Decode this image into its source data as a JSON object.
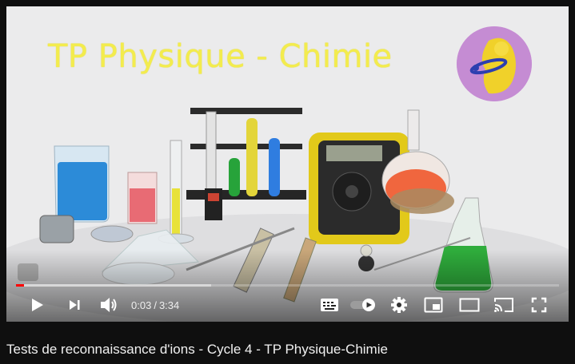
{
  "video": {
    "overlay_title": "TP Physique - Chimie",
    "title": "Tests de reconnaissance d'ions - Cycle 4 - TP Physique-Chimie"
  },
  "player": {
    "current_time": "0:03",
    "separator": "/",
    "duration": "3:34",
    "progress_fraction": 0.014,
    "buffered_fraction": 0.36,
    "autoplay_on": true
  },
  "icons": {
    "play": "play-icon",
    "next": "next-icon",
    "volume": "volume-icon",
    "subtitles": "subtitles-icon",
    "autoplay": "autoplay-toggle-icon",
    "settings": "gear-icon",
    "miniplayer": "miniplayer-icon",
    "theater": "theater-mode-icon",
    "cast": "cast-icon",
    "fullscreen": "fullscreen-icon"
  },
  "colors": {
    "progress": "#ff0000",
    "overlay_title": "#f3ec4d",
    "page_bg": "#0f0f0f"
  }
}
